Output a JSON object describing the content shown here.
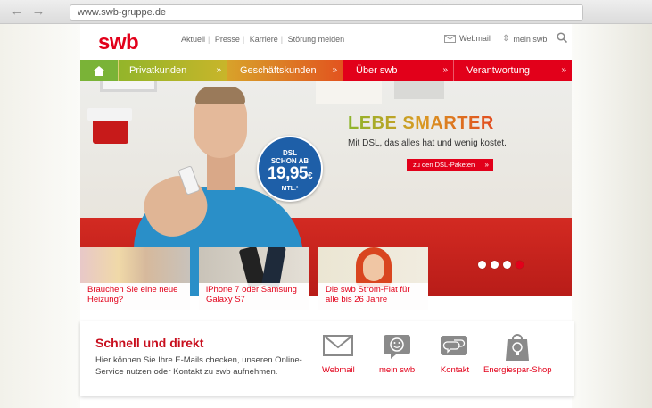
{
  "browser": {
    "url": "www.swb-gruppe.de"
  },
  "header": {
    "logo": "swb",
    "links": [
      "Aktuell",
      "Presse",
      "Karriere",
      "Störung melden"
    ],
    "webmail": "Webmail",
    "mein_swb": "mein swb"
  },
  "nav": {
    "items": [
      "Privatkunden",
      "Geschäftskunden",
      "Über swb",
      "Verantwortung"
    ],
    "chevron": "»"
  },
  "hero": {
    "headline": "LEBE SMARTER",
    "subline": "Mit DSL, das alles hat und wenig kostet.",
    "cta": "zu den DSL-Paketen",
    "badge": {
      "line1": "DSL",
      "line2": "SCHON AB",
      "price": "19,95",
      "currency": "€",
      "unit": "MTL.¹"
    }
  },
  "teasers": [
    "Brauchen Sie eine neue Heizung?",
    "iPhone 7 oder Samsung Galaxy S7",
    "Die swb Strom-Flat für alle bis 26 Jahre"
  ],
  "carousel": {
    "count": 4,
    "active_index": 3
  },
  "quick": {
    "title": "Schnell und direkt",
    "text": "Hier können Sie Ihre E-Mails checken, unseren Online-Service nutzen oder Kontakt zu swb aufnehmen.",
    "links": [
      "Webmail",
      "mein swb",
      "Kontakt",
      "Energiespar-Shop"
    ]
  },
  "colors": {
    "brand_red": "#e2001a",
    "green": "#7ab337",
    "blue_badge": "#1e5fa8"
  }
}
